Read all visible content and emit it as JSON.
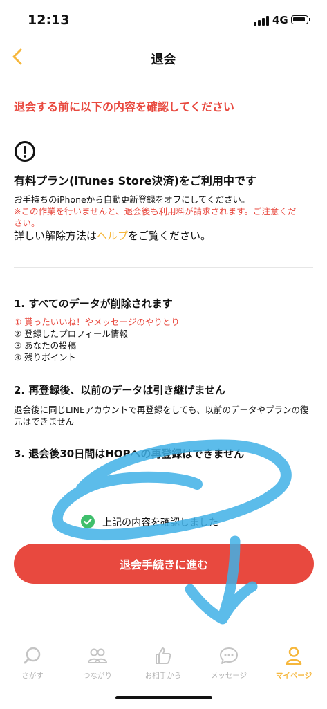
{
  "status_bar": {
    "time": "12:13",
    "network": "4G"
  },
  "nav": {
    "title": "退会",
    "back_icon": "chevron-left-icon"
  },
  "warning": "退会する前に以下の内容を確認してください",
  "plan": {
    "title": "有料プラン(iTunes Store決済)をご利用中です",
    "description": "お手持ちのiPhoneから自動更新登録をオフにしてください。",
    "note": "※この作業を行いませんと、退会後も利用料が請求されます。ご注意ください。",
    "help_prefix": "詳しい解除方法は",
    "help_link": "ヘルプ",
    "help_suffix": "をご覧ください。"
  },
  "sections": [
    {
      "title": "1. すべてのデータが削除されます",
      "items": [
        "① 貰ったいいね！やメッセージのやりとり",
        "② 登録したプロフィール情報",
        "③ あなたの投稿",
        "④ 残りポイント"
      ]
    },
    {
      "title": "2. 再登録後、以前のデータは引き継げません",
      "description": "退会後に同じLINEアカウントで再登録をしても、以前のデータやプランの復元はできません"
    },
    {
      "title": "3. 退会後30日間はHOPへの再登録はできません"
    }
  ],
  "confirm_label": "上記の内容を確認しました",
  "cta_label": "退会手続きに進む",
  "tabs": [
    {
      "label": "さがす",
      "icon": "search-icon"
    },
    {
      "label": "つながり",
      "icon": "people-icon"
    },
    {
      "label": "お相手から",
      "icon": "thumbs-up-icon"
    },
    {
      "label": "メッセージ",
      "icon": "chat-bubble-icon"
    },
    {
      "label": "マイページ",
      "icon": "person-icon",
      "active": true
    }
  ],
  "colors": {
    "accent": "#f6b73c",
    "danger": "#e8493f",
    "check": "#3fbf6c",
    "scribble": "#3fb0e6",
    "inactive": "#b4b4b4"
  }
}
